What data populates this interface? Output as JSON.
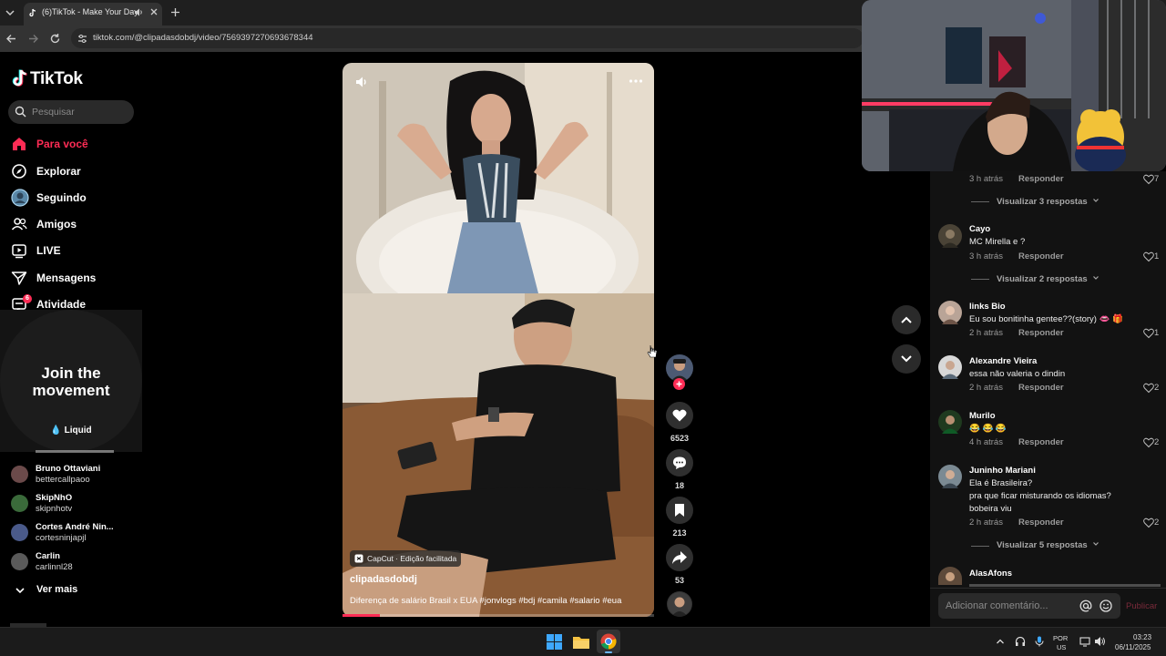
{
  "browser": {
    "tab_title": "(6)TikTok - Make Your Day",
    "url": "tiktok.com/@clipadasdobdj/video/7569397270693678344"
  },
  "sidebar": {
    "logo": "TikTok",
    "search_placeholder": "Pesquisar",
    "nav": [
      {
        "label": "Para você",
        "icon": "home-icon",
        "active": true
      },
      {
        "label": "Explorar",
        "icon": "compass-icon"
      },
      {
        "label": "Seguindo",
        "icon": "following-avatar-icon"
      },
      {
        "label": "Amigos",
        "icon": "friends-icon"
      },
      {
        "label": "LIVE",
        "icon": "live-icon"
      },
      {
        "label": "Mensagens",
        "icon": "send-icon"
      },
      {
        "label": "Atividade",
        "icon": "activity-icon",
        "badge": "6"
      }
    ],
    "ad": {
      "text_line1": "Join the",
      "text_line2": "movement",
      "brand": "Liquid"
    },
    "accounts": [
      {
        "name": "Bruno Ottaviani",
        "username": "bettercallpaoo"
      },
      {
        "name": "SkipNhO",
        "username": "skipnhotv"
      },
      {
        "name": "Cortes André Nin...",
        "username": "cortesninjapjl"
      },
      {
        "name": "Carlin",
        "username": "carlinnl28"
      }
    ],
    "see_more": "Ver mais"
  },
  "video": {
    "capcut_label": "CapCut · Edição facilitada",
    "author": "clipadasdobdj",
    "description": "Diferença de salário Brasil x EUA #jonvlogs #bdj #camila #salario #eua",
    "progress": 0.12
  },
  "actions": {
    "likes": "6523",
    "comments": "18",
    "saves": "213",
    "shares": "53"
  },
  "comments": {
    "top_meta": "3 h atrás",
    "top_likes": "7",
    "reply_label": "Responder",
    "items": [
      {
        "more": "Visualizar 3 respostas"
      },
      {
        "name": "Cayo",
        "text": [
          "MC Mirella e ?"
        ],
        "time": "3 h atrás",
        "likes": "1"
      },
      {
        "more": "Visualizar 2 respostas"
      },
      {
        "name": "links Bio",
        "text": [
          "Eu sou bonitinha gentee??(story) 👄 🎁"
        ],
        "time": "2 h atrás",
        "likes": "1"
      },
      {
        "name": "Alexandre Vieira",
        "text": [
          "essa não valeria o dindin"
        ],
        "time": "2 h atrás",
        "likes": "2"
      },
      {
        "name": "Murilo",
        "text": [
          "😂 😂 😂"
        ],
        "time": "4 h atrás",
        "likes": "2"
      },
      {
        "name": "Juninho Mariani",
        "text": [
          "Ela é Brasileira?",
          "pra que ficar misturando os idiomas?",
          "bobeira viu"
        ],
        "time": "2 h atrás",
        "likes": "2"
      },
      {
        "more": "Visualizar 5 respostas"
      },
      {
        "name": "AlasAfons"
      }
    ],
    "input_placeholder": "Adicionar comentário...",
    "publish": "Publicar"
  },
  "taskbar": {
    "lang_line1": "POR",
    "lang_line2": "US",
    "time": "03:23",
    "date": "06/11/2025"
  },
  "colors": {
    "accent": "#fe2c55",
    "background": "#000000",
    "panel": "#121212"
  }
}
